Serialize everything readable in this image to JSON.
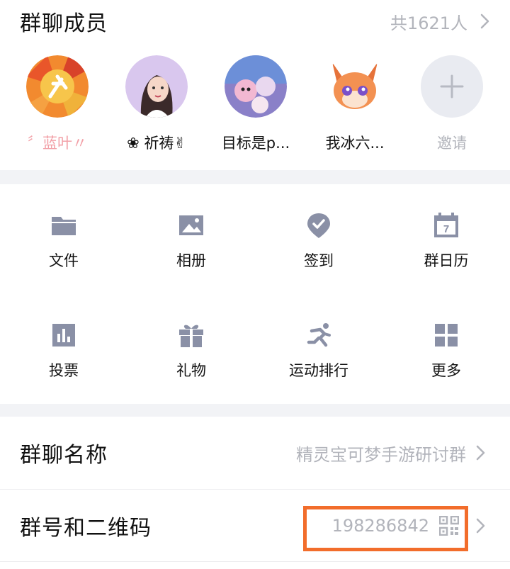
{
  "members": {
    "title": "群聊成员",
    "count": "共1621人",
    "avatars": [
      {
        "name": "〞蓝叶〃",
        "style": "pink"
      },
      {
        "name": "❀ 祈祷✌",
        "style": "normal"
      },
      {
        "name": "目标是p...",
        "style": "normal"
      },
      {
        "name": "我冰六...",
        "style": "normal"
      }
    ],
    "invite_label": "邀请"
  },
  "tools": [
    {
      "label": "文件",
      "icon": "folder-icon"
    },
    {
      "label": "相册",
      "icon": "image-icon"
    },
    {
      "label": "签到",
      "icon": "checkin-icon"
    },
    {
      "label": "群日历",
      "icon": "calendar-icon"
    },
    {
      "label": "投票",
      "icon": "vote-icon"
    },
    {
      "label": "礼物",
      "icon": "gift-icon"
    },
    {
      "label": "运动排行",
      "icon": "run-icon"
    },
    {
      "label": "更多",
      "icon": "grid-icon"
    }
  ],
  "calendar_day": "7",
  "rows": {
    "group_name": {
      "label": "群聊名称",
      "value": "精灵宝可梦手游研讨群"
    },
    "group_id": {
      "label": "群号和二维码",
      "value": "198286842"
    }
  },
  "colors": {
    "icon": "#8a90a6",
    "highlight": "#f26d2b",
    "muted": "#b2b4bb"
  }
}
